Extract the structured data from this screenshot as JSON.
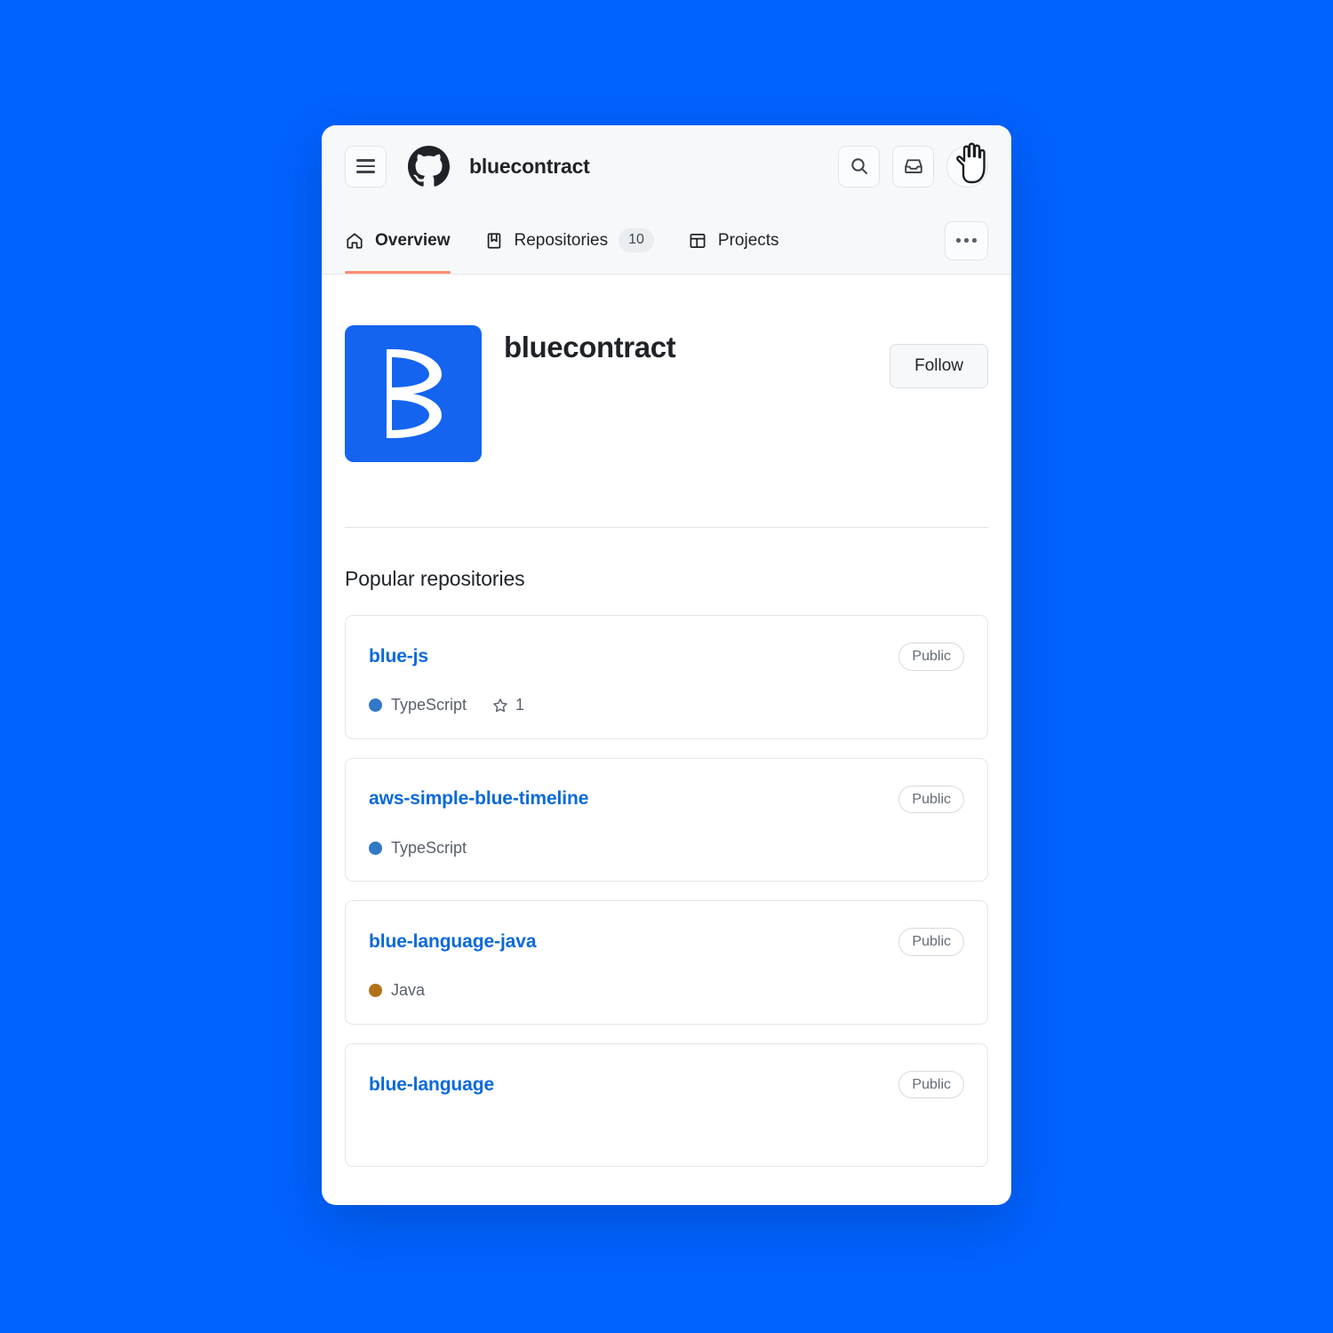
{
  "theme": {
    "page_background": "#0062ff",
    "window_background": "#ffffff",
    "header_background": "#f6f8fa",
    "link_color": "#0969da",
    "active_tab_underline": "#fd8c73",
    "avatar_background": "#1464f0"
  },
  "topbar": {
    "menu_icon": "hamburger-menu-icon",
    "logo_icon": "github-logo-icon",
    "account_name": "bluecontract",
    "search_icon": "search-icon",
    "inbox_icon": "inbox-icon",
    "avatar_icon": "user-avatar-icon",
    "cursor_icon": "pointing-hand-cursor-icon"
  },
  "tabs": [
    {
      "label": "Overview",
      "icon": "home-icon",
      "active": true,
      "count": null
    },
    {
      "label": "Repositories",
      "icon": "repo-book-icon",
      "active": false,
      "count": "10"
    },
    {
      "label": "Projects",
      "icon": "table-grid-icon",
      "active": false,
      "count": null
    }
  ],
  "overflow_menu": {
    "icon": "kebab-horizontal-icon",
    "label": "..."
  },
  "profile": {
    "name": "bluecontract",
    "avatar_letter": "B",
    "follow_label": "Follow"
  },
  "repositories_section": {
    "title": "Popular repositories",
    "items": [
      {
        "name": "blue-js",
        "visibility": "Public",
        "language": "TypeScript",
        "language_color": "#3178c6",
        "stars": "1"
      },
      {
        "name": "aws-simple-blue-timeline",
        "visibility": "Public",
        "language": "TypeScript",
        "language_color": "#3178c6",
        "stars": null
      },
      {
        "name": "blue-language-java",
        "visibility": "Public",
        "language": "Java",
        "language_color": "#b07219",
        "stars": null
      },
      {
        "name": "blue-language",
        "visibility": "Public",
        "language": null,
        "language_color": null,
        "stars": null
      }
    ]
  }
}
